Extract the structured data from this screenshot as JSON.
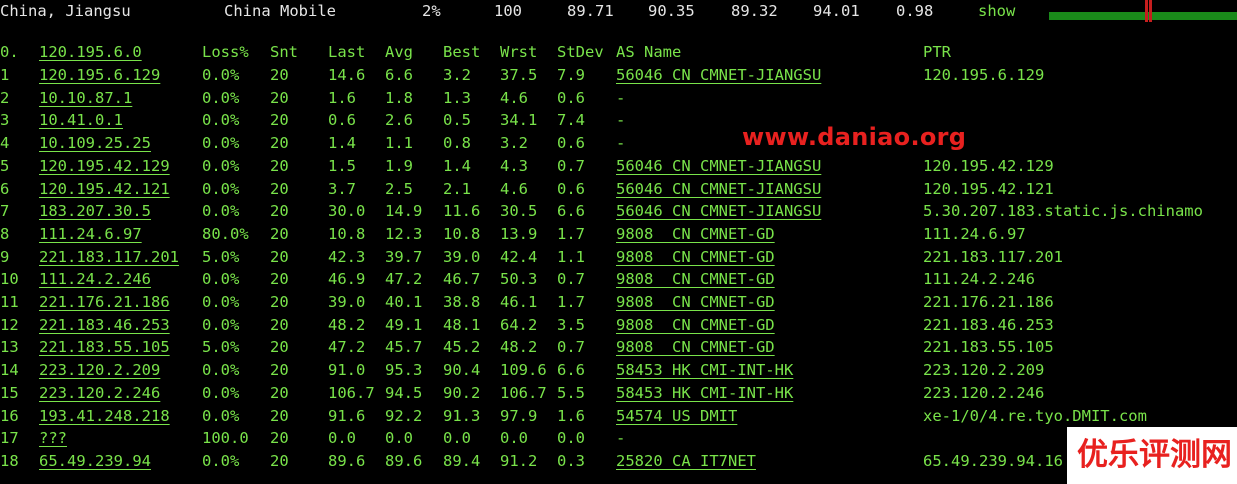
{
  "top": {
    "location": "China, Jiangsu",
    "isp": "China Mobile",
    "loss": "2%",
    "sent": "100",
    "last": "89.71",
    "avg": "90.35",
    "best": "89.32",
    "worst": "94.01",
    "stdev": "0.98",
    "show_label": "show"
  },
  "columns": {
    "hop": "0.",
    "host": "120.195.6.0",
    "loss": "Loss%",
    "snt": "Snt",
    "last": "Last",
    "avg": "Avg",
    "best": "Best",
    "wrst": "Wrst",
    "stdev": "StDev",
    "as": "AS Name",
    "ptr": "PTR"
  },
  "rows": [
    {
      "hop": "1",
      "host": "120.195.6.129",
      "loss": "0.0%",
      "snt": "20",
      "last": "14.6",
      "avg": "6.6",
      "best": "3.2",
      "wrst": "37.5",
      "stdev": "7.9",
      "as": "56046 CN CMNET-JIANGSU",
      "ptr": "120.195.6.129"
    },
    {
      "hop": "2",
      "host": "10.10.87.1",
      "loss": "0.0%",
      "snt": "20",
      "last": "1.6",
      "avg": "1.8",
      "best": "1.3",
      "wrst": "4.6",
      "stdev": "0.6",
      "as": "-",
      "ptr": ""
    },
    {
      "hop": "3",
      "host": "10.41.0.1",
      "loss": "0.0%",
      "snt": "20",
      "last": "0.6",
      "avg": "2.6",
      "best": "0.5",
      "wrst": "34.1",
      "stdev": "7.4",
      "as": "-",
      "ptr": ""
    },
    {
      "hop": "4",
      "host": "10.109.25.25",
      "loss": "0.0%",
      "snt": "20",
      "last": "1.4",
      "avg": "1.1",
      "best": "0.8",
      "wrst": "3.2",
      "stdev": "0.6",
      "as": "-",
      "ptr": ""
    },
    {
      "hop": "5",
      "host": "120.195.42.129",
      "loss": "0.0%",
      "snt": "20",
      "last": "1.5",
      "avg": "1.9",
      "best": "1.4",
      "wrst": "4.3",
      "stdev": "0.7",
      "as": "56046 CN CMNET-JIANGSU",
      "ptr": "120.195.42.129"
    },
    {
      "hop": "6",
      "host": "120.195.42.121",
      "loss": "0.0%",
      "snt": "20",
      "last": "3.7",
      "avg": "2.5",
      "best": "2.1",
      "wrst": "4.6",
      "stdev": "0.6",
      "as": "56046 CN CMNET-JIANGSU",
      "ptr": "120.195.42.121"
    },
    {
      "hop": "7",
      "host": "183.207.30.5",
      "loss": "0.0%",
      "snt": "20",
      "last": "30.0",
      "avg": "14.9",
      "best": "11.6",
      "wrst": "30.5",
      "stdev": "6.6",
      "as": "56046 CN CMNET-JIANGSU",
      "ptr": "5.30.207.183.static.js.chinamo"
    },
    {
      "hop": "8",
      "host": "111.24.6.97",
      "loss": "80.0%",
      "snt": "20",
      "last": "10.8",
      "avg": "12.3",
      "best": "10.8",
      "wrst": "13.9",
      "stdev": "1.7",
      "as": "9808  CN CMNET-GD",
      "ptr": "111.24.6.97"
    },
    {
      "hop": "9",
      "host": "221.183.117.201",
      "loss": "5.0%",
      "snt": "20",
      "last": "42.3",
      "avg": "39.7",
      "best": "39.0",
      "wrst": "42.4",
      "stdev": "1.1",
      "as": "9808  CN CMNET-GD",
      "ptr": "221.183.117.201"
    },
    {
      "hop": "10",
      "host": "111.24.2.246",
      "loss": "0.0%",
      "snt": "20",
      "last": "46.9",
      "avg": "47.2",
      "best": "46.7",
      "wrst": "50.3",
      "stdev": "0.7",
      "as": "9808  CN CMNET-GD",
      "ptr": "111.24.2.246"
    },
    {
      "hop": "11",
      "host": "221.176.21.186",
      "loss": "0.0%",
      "snt": "20",
      "last": "39.0",
      "avg": "40.1",
      "best": "38.8",
      "wrst": "46.1",
      "stdev": "1.7",
      "as": "9808  CN CMNET-GD",
      "ptr": "221.176.21.186"
    },
    {
      "hop": "12",
      "host": "221.183.46.253",
      "loss": "0.0%",
      "snt": "20",
      "last": "48.2",
      "avg": "49.1",
      "best": "48.1",
      "wrst": "64.2",
      "stdev": "3.5",
      "as": "9808  CN CMNET-GD",
      "ptr": "221.183.46.253"
    },
    {
      "hop": "13",
      "host": "221.183.55.105",
      "loss": "5.0%",
      "snt": "20",
      "last": "47.2",
      "avg": "45.7",
      "best": "45.2",
      "wrst": "48.2",
      "stdev": "0.7",
      "as": "9808  CN CMNET-GD",
      "ptr": "221.183.55.105"
    },
    {
      "hop": "14",
      "host": "223.120.2.209",
      "loss": "0.0%",
      "snt": "20",
      "last": "91.0",
      "avg": "95.3",
      "best": "90.4",
      "wrst": "109.6",
      "stdev": "6.6",
      "as": "58453 HK CMI-INT-HK",
      "ptr": "223.120.2.209"
    },
    {
      "hop": "15",
      "host": "223.120.2.246",
      "loss": "0.0%",
      "snt": "20",
      "last": "106.7",
      "avg": "94.5",
      "best": "90.2",
      "wrst": "106.7",
      "stdev": "5.5",
      "as": "58453 HK CMI-INT-HK",
      "ptr": "223.120.2.246"
    },
    {
      "hop": "16",
      "host": "193.41.248.218",
      "loss": "0.0%",
      "snt": "20",
      "last": "91.6",
      "avg": "92.2",
      "best": "91.3",
      "wrst": "97.9",
      "stdev": "1.6",
      "as": "54574 US DMIT",
      "ptr": "xe-1/0/4.re.tyo.DMIT.com"
    },
    {
      "hop": "17",
      "host": "???",
      "loss": "100.0",
      "snt": "20",
      "last": "0.0",
      "avg": "0.0",
      "best": "0.0",
      "wrst": "0.0",
      "stdev": "0.0",
      "as": "-",
      "ptr": ""
    },
    {
      "hop": "18",
      "host": "65.49.239.94",
      "loss": "0.0%",
      "snt": "20",
      "last": "89.6",
      "avg": "89.6",
      "best": "89.4",
      "wrst": "91.2",
      "stdev": "0.3",
      "as": "25820 CA IT7NET",
      "ptr": "65.49.239.94.16"
    }
  ],
  "watermark": "www.daniao.org",
  "logo": "优乐评测网",
  "colors": {
    "text_green": "#79e34a",
    "top_text": "#e6e6e6",
    "watermark_red": "#e8211f",
    "graph_green": "#1a8a1a",
    "graph_mark_red": "#c61e1e"
  }
}
